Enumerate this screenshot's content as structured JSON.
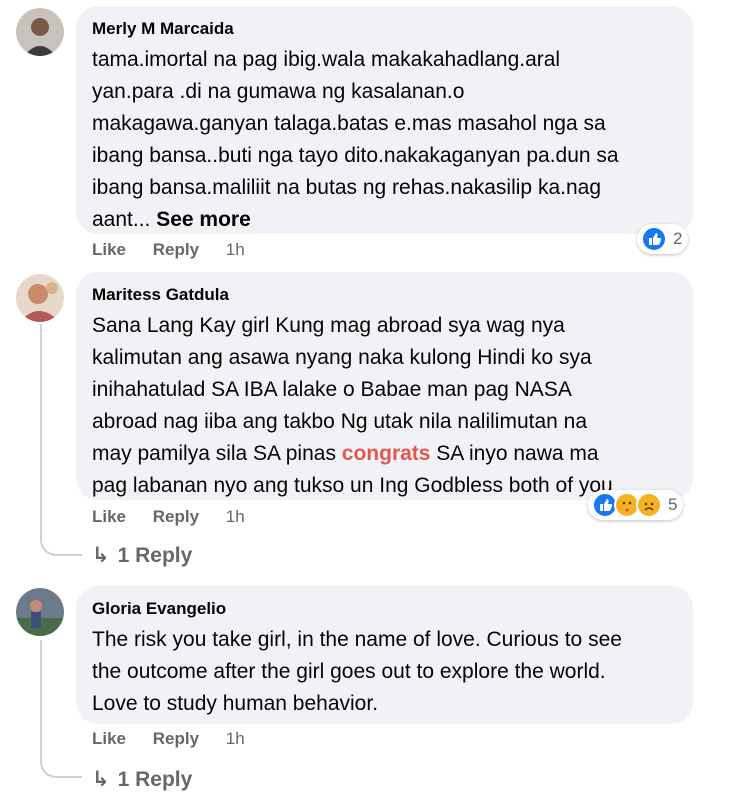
{
  "comments": [
    {
      "author": "Merly M Marcaida",
      "lines": [
        "tama.imortal na pag ibig.wala makakahadlang.aral",
        "yan.para .di na gumawa ng kasalanan.o",
        "makagawa.ganyan talaga.batas e.mas masahol nga sa",
        "ibang bansa..buti nga tayo dito.nakakaganyan pa.dun sa",
        "ibang bansa.maliliit na butas ng rehas.nakasilip ka.nag"
      ],
      "last_line": "aant...",
      "see_more": "See more",
      "actions": {
        "like": "Like",
        "reply": "Reply",
        "time": "1h"
      },
      "reaction_count": "2",
      "reaction_icons": [
        "like-icon"
      ]
    },
    {
      "author": "Maritess Gatdula",
      "lines": [
        "Sana Lang Kay girl Kung mag abroad sya wag nya",
        "kalimutan ang asawa nyang naka kulong Hindi ko sya",
        "inihahatulad SA IBA lalake o Babae man pag NASA",
        "abroad nag iiba ang takbo Ng utak nila nalilimutan na"
      ],
      "line5_pre": "may pamilya sila SA pinas ",
      "line5_highlight": "congrats",
      "line5_post": " SA inyo nawa ma",
      "line6": "pag labanan nyo ang tukso un Ing Godbless both of you",
      "actions": {
        "like": "Like",
        "reply": "Reply",
        "time": "1h"
      },
      "reaction_count": "5",
      "reaction_icons": [
        "like-icon",
        "care-icon",
        "sad-icon"
      ],
      "replies_label": "1 Reply"
    },
    {
      "author": "Gloria Evangelio",
      "lines": [
        "The risk you take girl, in the name of love. Curious to see",
        "the outcome after the girl goes out to explore the world.",
        "Love to study human behavior."
      ],
      "actions": {
        "like": "Like",
        "reply": "Reply",
        "time": "1h"
      },
      "replies_label": "1 Reply"
    }
  ],
  "colors": {
    "bubble": "#f0f2f5",
    "meta": "#65676b",
    "like_blue": "#1877f2",
    "highlight": "#e4574e"
  }
}
